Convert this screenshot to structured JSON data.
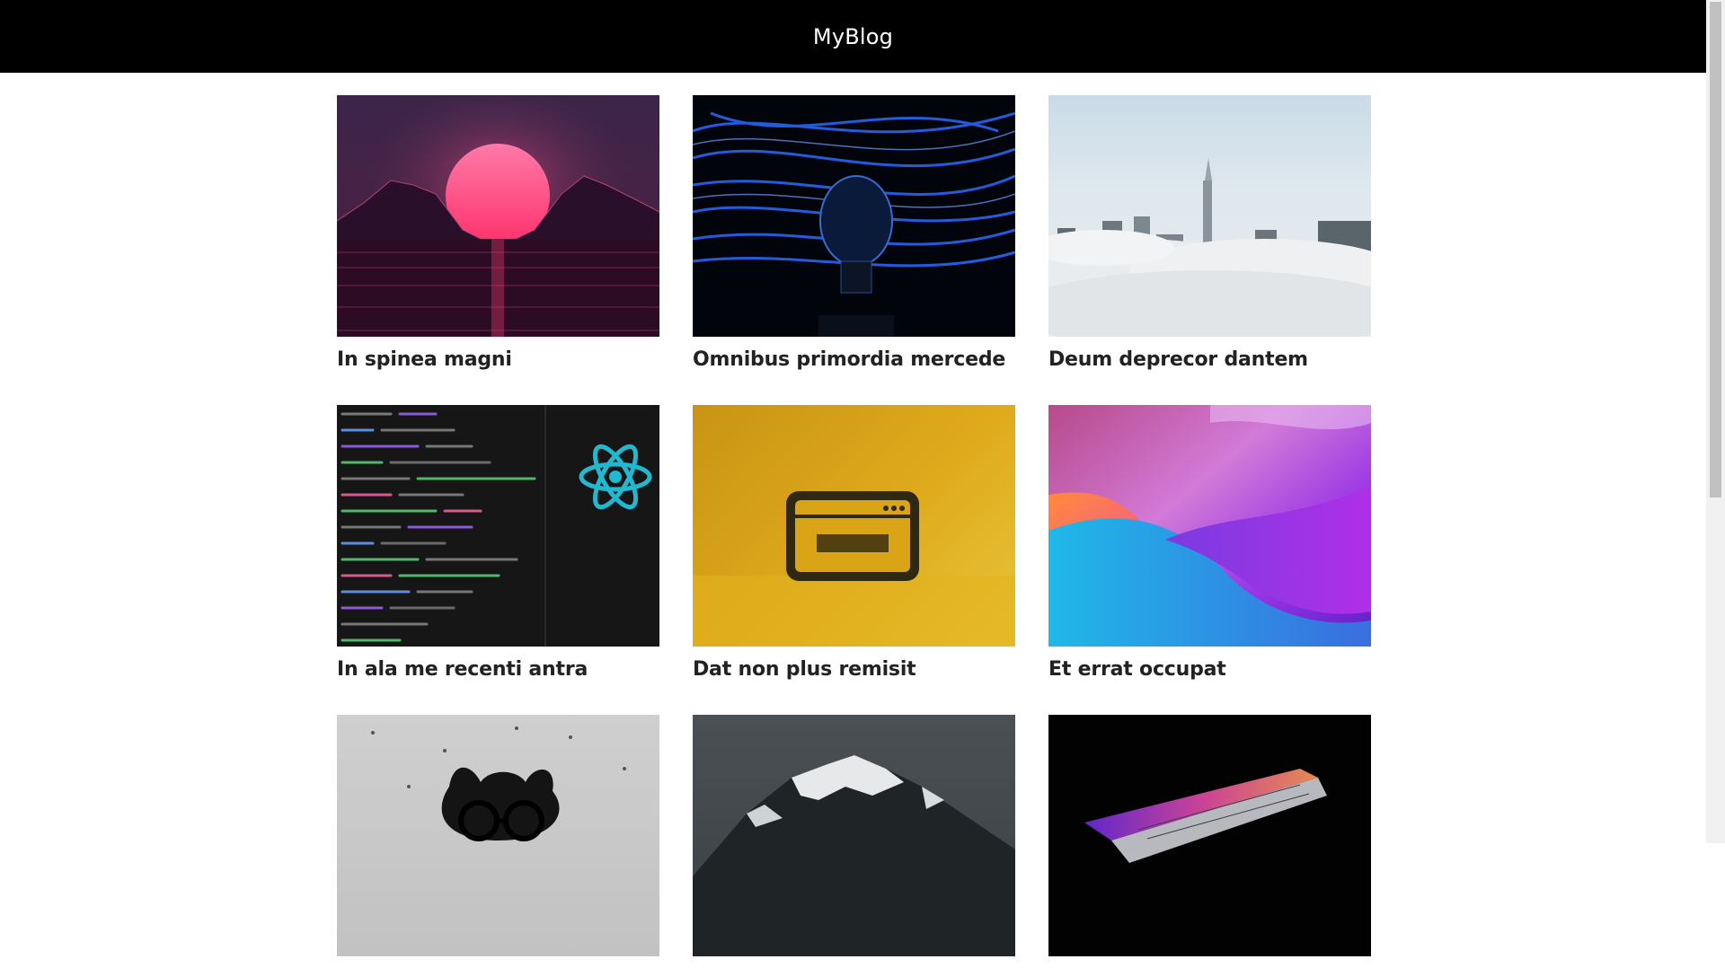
{
  "header": {
    "brand": "MyBlog"
  },
  "posts": [
    {
      "title": "In spinea magni",
      "image": "synthwave-sunset-image"
    },
    {
      "title": "Omnibus primordia mercede",
      "image": "lightbulb-blue-light-image"
    },
    {
      "title": "Deum deprecor dantem",
      "image": "city-above-clouds-image"
    },
    {
      "title": "In ala me recenti antra",
      "image": "react-code-editor-image"
    },
    {
      "title": "Dat non plus remisit",
      "image": "html-icon-yellow-image"
    },
    {
      "title": "Et errat occupat",
      "image": "abstract-gradient-waves-image"
    },
    {
      "title": "",
      "image": "dog-with-glasses-image"
    },
    {
      "title": "",
      "image": "snowy-mountain-image"
    },
    {
      "title": "",
      "image": "laptop-neon-image"
    }
  ]
}
